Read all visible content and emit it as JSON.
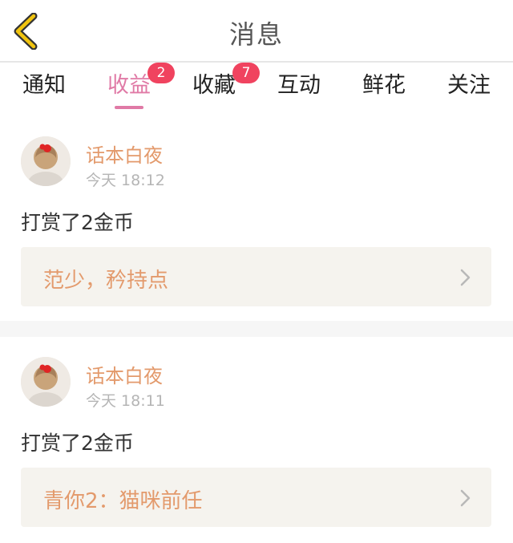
{
  "header": {
    "title": "消息",
    "back_icon": "chevron-left-icon",
    "accent": "#f1c40f"
  },
  "tabs": [
    {
      "label": "通知",
      "badge": null,
      "active": false
    },
    {
      "label": "收益",
      "badge": "2",
      "active": true
    },
    {
      "label": "收藏",
      "badge": "7",
      "active": false
    },
    {
      "label": "互动",
      "badge": null,
      "active": false
    },
    {
      "label": "鲜花",
      "badge": null,
      "active": false
    },
    {
      "label": "关注",
      "badge": null,
      "active": false
    }
  ],
  "colors": {
    "active_tab": "#e07aa6",
    "badge": "#f0435f",
    "name": "#e39a6c",
    "link_bg": "#f5f3ee"
  },
  "messages": [
    {
      "sender": "话本白夜",
      "time": "今天 18:12",
      "text": "打赏了2金币",
      "work_title": "范少，矜持点"
    },
    {
      "sender": "话本白夜",
      "time": "今天 18:11",
      "text": "打赏了2金币",
      "work_title": "青你2：猫咪前任"
    }
  ]
}
